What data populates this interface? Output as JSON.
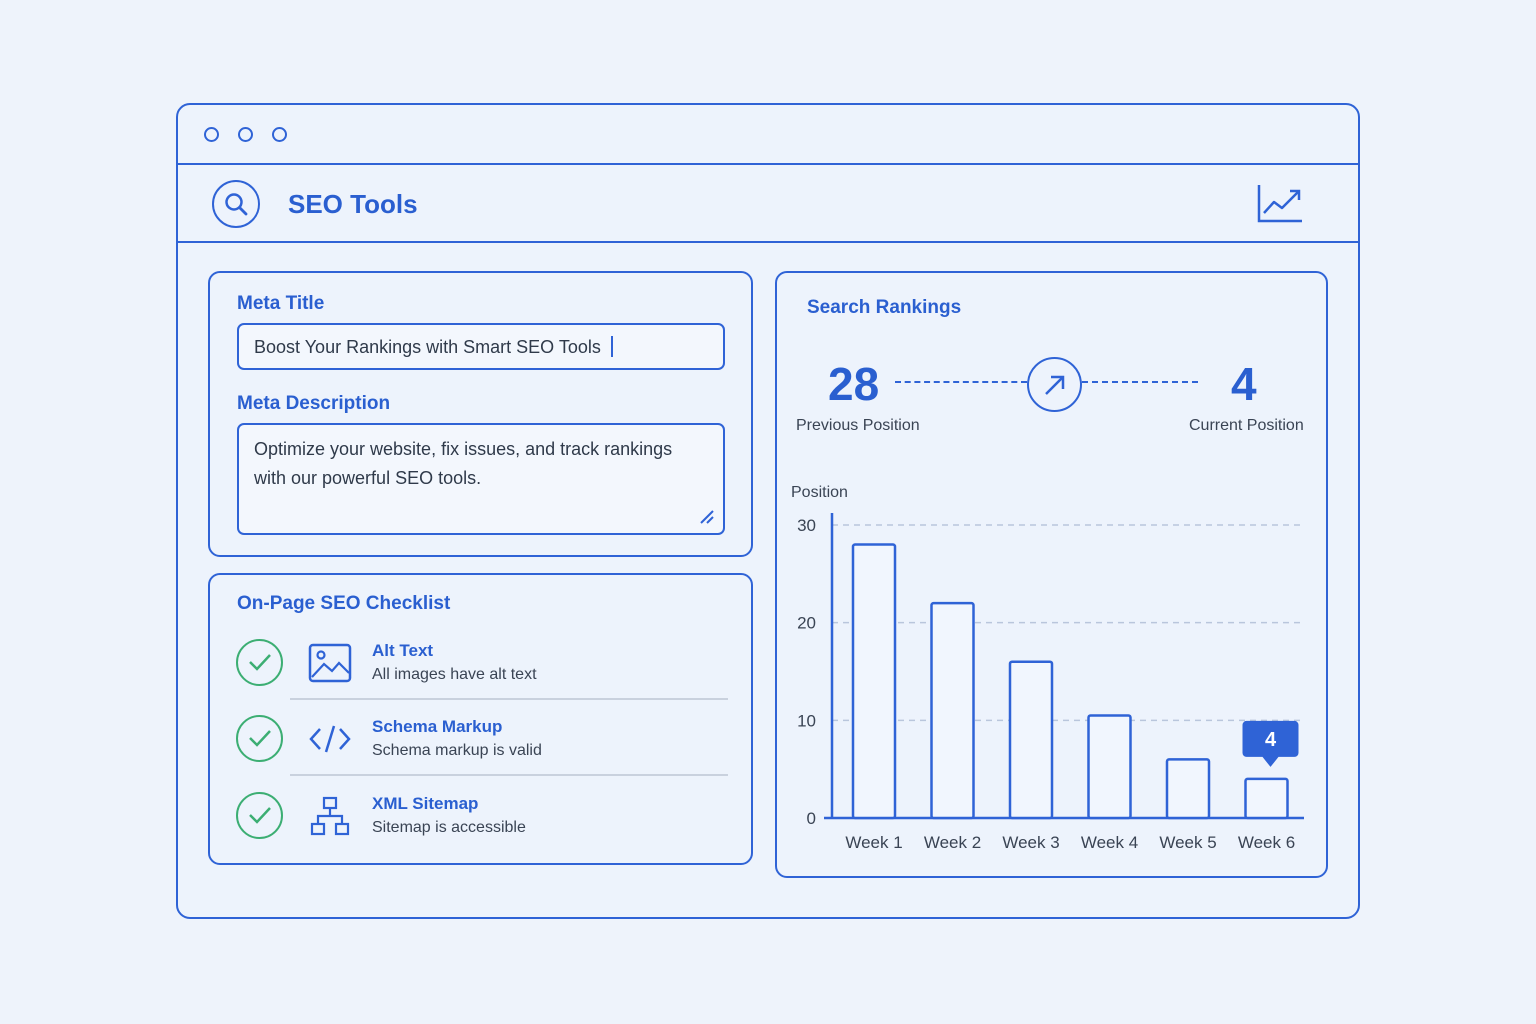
{
  "app": {
    "title": "SEO Tools"
  },
  "window": {
    "controls": [
      "close",
      "minimize",
      "maximize"
    ]
  },
  "icons": {
    "search": "search-icon",
    "trend": "trending-up-icon"
  },
  "meta": {
    "title_label": "Meta Title",
    "title_value": "Boost Your Rankings with Smart SEO Tools",
    "description_label": "Meta Description",
    "description_value": "Optimize your website, fix issues, and track rankings with our powerful SEO tools."
  },
  "checklist": {
    "title": "On-Page SEO Checklist",
    "items": [
      {
        "title": "Alt Text",
        "subtitle": "All images have alt text",
        "icon": "image-icon",
        "status": "passed"
      },
      {
        "title": "Schema Markup",
        "subtitle": "Schema markup is valid",
        "icon": "code-icon",
        "status": "passed"
      },
      {
        "title": "XML Sitemap",
        "subtitle": "Sitemap is accessible",
        "icon": "sitemap-icon",
        "status": "passed"
      }
    ]
  },
  "rankings": {
    "title": "Search Rankings",
    "previous_value": "28",
    "previous_label": "Previous Position",
    "current_value": "4",
    "current_label": "Current Position"
  },
  "colors": {
    "accent": "#2f63d6",
    "success": "#3cae73",
    "background": "#eef3fb"
  },
  "chart_data": {
    "type": "bar",
    "ylabel": "Position",
    "categories": [
      "Week 1",
      "Week 2",
      "Week 3",
      "Week 4",
      "Week 5",
      "Week 6"
    ],
    "values": [
      28,
      22,
      16,
      10.5,
      6,
      4
    ],
    "ylim": [
      0,
      30
    ],
    "yticks": [
      0,
      10,
      20,
      30
    ],
    "grid": true,
    "highlight": {
      "category": "Week 6",
      "label": "4"
    }
  }
}
